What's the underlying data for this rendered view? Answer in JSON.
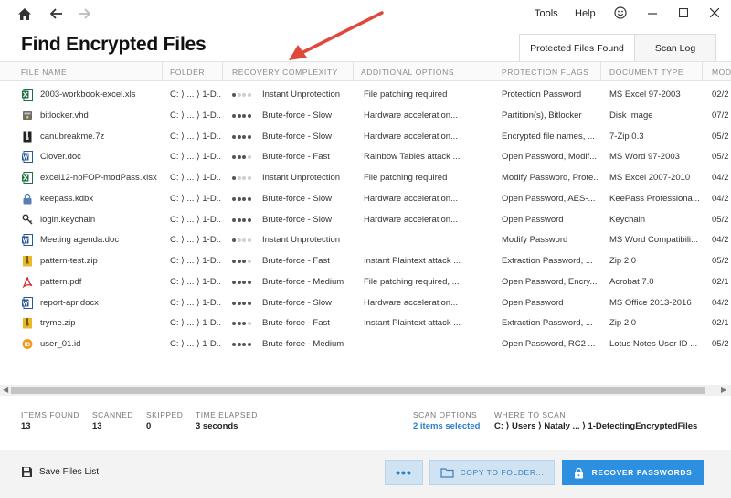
{
  "menu": {
    "tools": "Tools",
    "help": "Help"
  },
  "page_title": "Find Encrypted Files",
  "tabs": [
    {
      "label": "Protected Files Found",
      "active": true
    },
    {
      "label": "Scan Log",
      "active": false
    }
  ],
  "columns": [
    "FILE NAME",
    "FOLDER",
    "RECOVERY COMPLEXITY",
    "ADDITIONAL OPTIONS",
    "PROTECTION FLAGS",
    "DOCUMENT TYPE",
    "MODI"
  ],
  "rows": [
    {
      "icon": "excel-file-icon",
      "name": "2003-workbook-excel.xls",
      "folder": "C: ⟩ ... ⟩ 1-D...",
      "level": 1,
      "complexity": "Instant Unprotection",
      "options": "File patching required",
      "flags": "Protection Password",
      "type": "MS Excel 97-2003",
      "modified": "02/2"
    },
    {
      "icon": "bitlocker-file-icon",
      "name": "bitlocker.vhd",
      "folder": "C: ⟩ ... ⟩ 1-D...",
      "level": 4,
      "complexity": "Brute-force - Slow",
      "options": "Hardware acceleration...",
      "flags": "Partition(s), Bitlocker",
      "type": "Disk Image",
      "modified": "07/2"
    },
    {
      "icon": "archive-file-icon",
      "name": "canubreakme.7z",
      "folder": "C: ⟩ ... ⟩ 1-D...",
      "level": 4,
      "complexity": "Brute-force - Slow",
      "options": "Hardware acceleration...",
      "flags": "Encrypted file names, ...",
      "type": "7-Zip 0.3",
      "modified": "05/2"
    },
    {
      "icon": "word-file-icon",
      "name": "Clover.doc",
      "folder": "C: ⟩ ... ⟩ 1-D...",
      "level": 3,
      "complexity": "Brute-force - Fast",
      "options": "Rainbow Tables attack ...",
      "flags": "Open Password, Modif...",
      "type": "MS Word 97-2003",
      "modified": "05/2"
    },
    {
      "icon": "excel-file-icon",
      "name": "excel12-noFOP-modPass.xlsx",
      "folder": "C: ⟩ ... ⟩ 1-D...",
      "level": 1,
      "complexity": "Instant Unprotection",
      "options": "File patching required",
      "flags": "Modify Password, Prote...",
      "type": "MS Excel 2007-2010",
      "modified": "04/2"
    },
    {
      "icon": "keepass-file-icon",
      "name": "keepass.kdbx",
      "folder": "C: ⟩ ... ⟩ 1-D...",
      "level": 4,
      "complexity": "Brute-force - Slow",
      "options": "Hardware acceleration...",
      "flags": "Open Password, AES-...",
      "type": "KeePass Professiona...",
      "modified": "04/2"
    },
    {
      "icon": "keychain-file-icon",
      "name": "login.keychain",
      "folder": "C: ⟩ ... ⟩ 1-D...",
      "level": 4,
      "complexity": "Brute-force - Slow",
      "options": "Hardware acceleration...",
      "flags": "Open Password",
      "type": "Keychain",
      "modified": "05/2"
    },
    {
      "icon": "word-file-icon",
      "name": "Meeting agenda.doc",
      "folder": "C: ⟩ ... ⟩ 1-D...",
      "level": 1,
      "complexity": "Instant Unprotection",
      "options": "",
      "flags": "Modify Password",
      "type": "MS Word Compatibili...",
      "modified": "04/2"
    },
    {
      "icon": "zip-file-icon",
      "name": "pattern-test.zip",
      "folder": "C: ⟩ ... ⟩ 1-D...",
      "level": 3,
      "complexity": "Brute-force - Fast",
      "options": "Instant Plaintext attack ...",
      "flags": "Extraction Password, ...",
      "type": "Zip 2.0",
      "modified": "05/2"
    },
    {
      "icon": "pdf-file-icon",
      "name": "pattern.pdf",
      "folder": "C: ⟩ ... ⟩ 1-D...",
      "level": 4,
      "complexity": "Brute-force - Medium",
      "options": "File patching required, ...",
      "flags": "Open Password, Encry...",
      "type": "Acrobat 7.0",
      "modified": "02/1"
    },
    {
      "icon": "word-file-icon",
      "name": "report-apr.docx",
      "folder": "C: ⟩ ... ⟩ 1-D...",
      "level": 4,
      "complexity": "Brute-force - Slow",
      "options": "Hardware acceleration...",
      "flags": "Open Password",
      "type": "MS Office 2013-2016",
      "modified": "04/2"
    },
    {
      "icon": "zip-file-icon",
      "name": "tryme.zip",
      "folder": "C: ⟩ ... ⟩ 1-D...",
      "level": 3,
      "complexity": "Brute-force - Fast",
      "options": "Instant Plaintext attack ...",
      "flags": "Extraction Password, ...",
      "type": "Zip 2.0",
      "modified": "02/1"
    },
    {
      "icon": "lotus-file-icon",
      "name": "user_01.id",
      "folder": "C: ⟩ ... ⟩ 1-D...",
      "level": 4,
      "complexity": "Brute-force - Medium",
      "options": "",
      "flags": "Open Password, RC2 ...",
      "type": "Lotus Notes User ID ...",
      "modified": "05/2"
    }
  ],
  "stats": {
    "items_found_label": "ITEMS FOUND",
    "items_found": "13",
    "scanned_label": "SCANNED",
    "scanned": "13",
    "skipped_label": "SKIPPED",
    "skipped": "0",
    "elapsed_label": "TIME ELAPSED",
    "elapsed": "3 seconds",
    "scan_options_label": "SCAN OPTIONS",
    "scan_options": "2 items selected",
    "where_label": "WHERE TO SCAN",
    "where": "C: ⟩ Users ⟩ Nataly ... ⟩ 1-DetectingEncryptedFiles"
  },
  "bottom": {
    "save_list": "Save Files List",
    "more": "•••",
    "copy_to_folder": "COPY TO FOLDER...",
    "recover": "RECOVER PASSWORDS"
  },
  "colors": {
    "accent": "#2d8fe0",
    "accent_light": "#cfe3f3",
    "link": "#2a7fc9"
  }
}
